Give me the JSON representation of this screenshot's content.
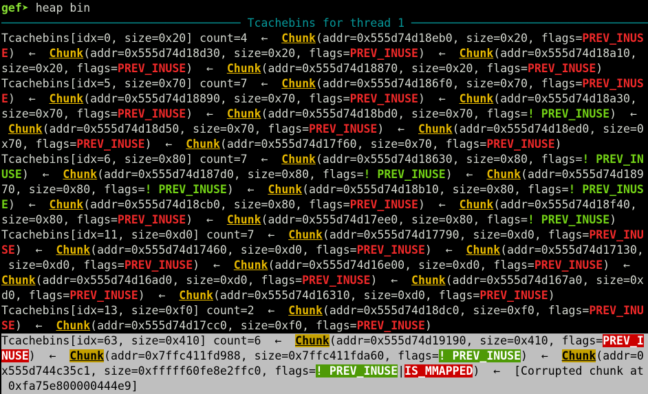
{
  "prompt": {
    "name": "gef",
    "arrow": "➤",
    "command": "heap bin"
  },
  "header": {
    "title": "Tcachebins for thread 1"
  },
  "colors": {
    "background": "#000000",
    "chunk": "#e6b800",
    "flag_inuse": "#ef2929",
    "flag_not_inuse": "#73d216",
    "header": "#06989a",
    "prompt": "#8ae234",
    "selection_background": "#bfbfbf"
  },
  "lines": [
    {
      "selected": false,
      "segs": [
        {
          "c": "plain",
          "t": "Tcachebins[idx=0, size=0x20] count=4  ←  "
        },
        {
          "c": "chunk",
          "t": "Chunk"
        },
        {
          "c": "plain",
          "t": "(addr=0x555d74d18eb0, size=0x20, flags="
        },
        {
          "c": "flag-red",
          "t": "PREV_INUS"
        }
      ]
    },
    {
      "selected": false,
      "segs": [
        {
          "c": "flag-red",
          "t": "E"
        },
        {
          "c": "plain",
          "t": ")  ←  "
        },
        {
          "c": "chunk",
          "t": "Chunk"
        },
        {
          "c": "plain",
          "t": "(addr=0x555d74d18d30, size=0x20, flags="
        },
        {
          "c": "flag-red",
          "t": "PREV_INUSE"
        },
        {
          "c": "plain",
          "t": ")  ←  "
        },
        {
          "c": "chunk",
          "t": "Chunk"
        },
        {
          "c": "plain",
          "t": "(addr=0x555d74d18a10,"
        }
      ]
    },
    {
      "selected": false,
      "segs": [
        {
          "c": "plain",
          "t": "size=0x20, flags="
        },
        {
          "c": "flag-red",
          "t": "PREV_INUSE"
        },
        {
          "c": "plain",
          "t": ")  ←  "
        },
        {
          "c": "chunk",
          "t": "Chunk"
        },
        {
          "c": "plain",
          "t": "(addr=0x555d74d18870, size=0x20, flags="
        },
        {
          "c": "flag-red",
          "t": "PREV_INUSE"
        },
        {
          "c": "plain",
          "t": ")"
        }
      ]
    },
    {
      "selected": false,
      "segs": [
        {
          "c": "plain",
          "t": "Tcachebins[idx=5, size=0x70] count=7  ←  "
        },
        {
          "c": "chunk",
          "t": "Chunk"
        },
        {
          "c": "plain",
          "t": "(addr=0x555d74d186f0, size=0x70, flags="
        },
        {
          "c": "flag-red",
          "t": "PREV_INUS"
        }
      ]
    },
    {
      "selected": false,
      "segs": [
        {
          "c": "flag-red",
          "t": "E"
        },
        {
          "c": "plain",
          "t": ")  ←  "
        },
        {
          "c": "chunk",
          "t": "Chunk"
        },
        {
          "c": "plain",
          "t": "(addr=0x555d74d18890, size=0x70, flags="
        },
        {
          "c": "flag-red",
          "t": "PREV_INUSE"
        },
        {
          "c": "plain",
          "t": ")  ←  "
        },
        {
          "c": "chunk",
          "t": "Chunk"
        },
        {
          "c": "plain",
          "t": "(addr=0x555d74d18a30,"
        }
      ]
    },
    {
      "selected": false,
      "segs": [
        {
          "c": "plain",
          "t": "size=0x70, flags="
        },
        {
          "c": "flag-red",
          "t": "PREV_INUSE"
        },
        {
          "c": "plain",
          "t": ")  ←  "
        },
        {
          "c": "chunk",
          "t": "Chunk"
        },
        {
          "c": "plain",
          "t": "(addr=0x555d74d18bd0, size=0x70, flags="
        },
        {
          "c": "flag-green",
          "t": "! PREV_INUSE"
        },
        {
          "c": "plain",
          "t": ")  ←"
        }
      ]
    },
    {
      "selected": false,
      "segs": [
        {
          "c": "plain",
          "t": " "
        },
        {
          "c": "chunk",
          "t": "Chunk"
        },
        {
          "c": "plain",
          "t": "(addr=0x555d74d18d50, size=0x70, flags="
        },
        {
          "c": "flag-red",
          "t": "PREV_INUSE"
        },
        {
          "c": "plain",
          "t": ")  ←  "
        },
        {
          "c": "chunk",
          "t": "Chunk"
        },
        {
          "c": "plain",
          "t": "(addr=0x555d74d18ed0, size=0"
        }
      ]
    },
    {
      "selected": false,
      "segs": [
        {
          "c": "plain",
          "t": "x70, flags="
        },
        {
          "c": "flag-red",
          "t": "PREV_INUSE"
        },
        {
          "c": "plain",
          "t": ")  ←  "
        },
        {
          "c": "chunk",
          "t": "Chunk"
        },
        {
          "c": "plain",
          "t": "(addr=0x555d74d17f60, size=0x70, flags="
        },
        {
          "c": "flag-red",
          "t": "PREV_INUSE"
        },
        {
          "c": "plain",
          "t": ")"
        }
      ]
    },
    {
      "selected": false,
      "segs": [
        {
          "c": "plain",
          "t": "Tcachebins[idx=6, size=0x80] count=7  ←  "
        },
        {
          "c": "chunk",
          "t": "Chunk"
        },
        {
          "c": "plain",
          "t": "(addr=0x555d74d18630, size=0x80, flags="
        },
        {
          "c": "flag-green",
          "t": "! PREV_IN"
        }
      ]
    },
    {
      "selected": false,
      "segs": [
        {
          "c": "flag-green",
          "t": "USE"
        },
        {
          "c": "plain",
          "t": ")  ←  "
        },
        {
          "c": "chunk",
          "t": "Chunk"
        },
        {
          "c": "plain",
          "t": "(addr=0x555d74d187d0, size=0x80, flags="
        },
        {
          "c": "flag-green",
          "t": "! PREV_INUSE"
        },
        {
          "c": "plain",
          "t": ")  ←  "
        },
        {
          "c": "chunk",
          "t": "Chunk"
        },
        {
          "c": "plain",
          "t": "(addr=0x555d74d189"
        }
      ]
    },
    {
      "selected": false,
      "segs": [
        {
          "c": "plain",
          "t": "70, size=0x80, flags="
        },
        {
          "c": "flag-green",
          "t": "! PREV_INUSE"
        },
        {
          "c": "plain",
          "t": ")  ←  "
        },
        {
          "c": "chunk",
          "t": "Chunk"
        },
        {
          "c": "plain",
          "t": "(addr=0x555d74d18b10, size=0x80, flags="
        },
        {
          "c": "flag-green",
          "t": "! PREV_INUS"
        }
      ]
    },
    {
      "selected": false,
      "segs": [
        {
          "c": "flag-green",
          "t": "E"
        },
        {
          "c": "plain",
          "t": ")  ←  "
        },
        {
          "c": "chunk",
          "t": "Chunk"
        },
        {
          "c": "plain",
          "t": "(addr=0x555d74d18cb0, size=0x80, flags="
        },
        {
          "c": "flag-red",
          "t": "PREV_INUSE"
        },
        {
          "c": "plain",
          "t": ")  ←  "
        },
        {
          "c": "chunk",
          "t": "Chunk"
        },
        {
          "c": "plain",
          "t": "(addr=0x555d74d18f40,"
        }
      ]
    },
    {
      "selected": false,
      "segs": [
        {
          "c": "plain",
          "t": "size=0x80, flags="
        },
        {
          "c": "flag-red",
          "t": "PREV_INUSE"
        },
        {
          "c": "plain",
          "t": ")  ←  "
        },
        {
          "c": "chunk",
          "t": "Chunk"
        },
        {
          "c": "plain",
          "t": "(addr=0x555d74d17ee0, size=0x80, flags="
        },
        {
          "c": "flag-green",
          "t": "! PREV_INUSE"
        },
        {
          "c": "plain",
          "t": ")"
        }
      ]
    },
    {
      "selected": false,
      "segs": [
        {
          "c": "plain",
          "t": "Tcachebins[idx=11, size=0xd0] count=7  ←  "
        },
        {
          "c": "chunk",
          "t": "Chunk"
        },
        {
          "c": "plain",
          "t": "(addr=0x555d74d17790, size=0xd0, flags="
        },
        {
          "c": "flag-red",
          "t": "PREV_INU"
        }
      ]
    },
    {
      "selected": false,
      "segs": [
        {
          "c": "flag-red",
          "t": "SE"
        },
        {
          "c": "plain",
          "t": ")  ←  "
        },
        {
          "c": "chunk",
          "t": "Chunk"
        },
        {
          "c": "plain",
          "t": "(addr=0x555d74d17460, size=0xd0, flags="
        },
        {
          "c": "flag-red",
          "t": "PREV_INUSE"
        },
        {
          "c": "plain",
          "t": ")  ←  "
        },
        {
          "c": "chunk",
          "t": "Chunk"
        },
        {
          "c": "plain",
          "t": "(addr=0x555d74d17130,"
        }
      ]
    },
    {
      "selected": false,
      "segs": [
        {
          "c": "plain",
          "t": " size=0xd0, flags="
        },
        {
          "c": "flag-red",
          "t": "PREV_INUSE"
        },
        {
          "c": "plain",
          "t": ")  ←  "
        },
        {
          "c": "chunk",
          "t": "Chunk"
        },
        {
          "c": "plain",
          "t": "(addr=0x555d74d16e00, size=0xd0, flags="
        },
        {
          "c": "flag-red",
          "t": "PREV_INUSE"
        },
        {
          "c": "plain",
          "t": ")  ←"
        }
      ]
    },
    {
      "selected": false,
      "segs": [
        {
          "c": "chunk",
          "t": "Chunk"
        },
        {
          "c": "plain",
          "t": "(addr=0x555d74d16ad0, size=0xd0, flags="
        },
        {
          "c": "flag-red",
          "t": "PREV_INUSE"
        },
        {
          "c": "plain",
          "t": ")  ←  "
        },
        {
          "c": "chunk",
          "t": "Chunk"
        },
        {
          "c": "plain",
          "t": "(addr=0x555d74d167a0, size=0x"
        }
      ]
    },
    {
      "selected": false,
      "segs": [
        {
          "c": "plain",
          "t": "d0, flags="
        },
        {
          "c": "flag-red",
          "t": "PREV_INUSE"
        },
        {
          "c": "plain",
          "t": ")  ←  "
        },
        {
          "c": "chunk",
          "t": "Chunk"
        },
        {
          "c": "plain",
          "t": "(addr=0x555d74d16310, size=0xd0, flags="
        },
        {
          "c": "flag-red",
          "t": "PREV_INUSE"
        },
        {
          "c": "plain",
          "t": ")"
        }
      ]
    },
    {
      "selected": false,
      "segs": [
        {
          "c": "plain",
          "t": "Tcachebins[idx=13, size=0xf0] count=2  ←  "
        },
        {
          "c": "chunk",
          "t": "Chunk"
        },
        {
          "c": "plain",
          "t": "(addr=0x555d74d18dc0, size=0xf0, flags="
        },
        {
          "c": "flag-red",
          "t": "PREV_INU"
        }
      ]
    },
    {
      "selected": false,
      "segs": [
        {
          "c": "flag-red",
          "t": "SE"
        },
        {
          "c": "plain",
          "t": ")  ←  "
        },
        {
          "c": "chunk",
          "t": "Chunk"
        },
        {
          "c": "plain",
          "t": "(addr=0x555d74d17cc0, size=0xf0, flags="
        },
        {
          "c": "flag-red",
          "t": "PREV_INUSE"
        },
        {
          "c": "plain",
          "t": ")"
        }
      ]
    },
    {
      "selected": true,
      "segs": [
        {
          "c": "plain",
          "t": "Tcachebins[idx=63, size=0x410] count=6  ←  "
        },
        {
          "c": "chunk",
          "t": "Chunk"
        },
        {
          "c": "plain",
          "t": "(addr=0x555d74d19190, size=0x410, flags="
        },
        {
          "c": "flag-red",
          "t": "PREV_I"
        }
      ]
    },
    {
      "selected": true,
      "segs": [
        {
          "c": "flag-red",
          "t": "NUSE"
        },
        {
          "c": "plain",
          "t": ")  ←  "
        },
        {
          "c": "chunk",
          "t": "Chunk"
        },
        {
          "c": "plain",
          "t": "(addr=0x7ffc411fd988, size=0x7ffc411fda60, flags="
        },
        {
          "c": "flag-green",
          "t": "! PREV_INUSE"
        },
        {
          "c": "plain",
          "t": ")  ←  "
        },
        {
          "c": "chunk",
          "t": "Chunk"
        },
        {
          "c": "plain",
          "t": "(addr=0"
        }
      ]
    },
    {
      "selected": true,
      "segs": [
        {
          "c": "plain",
          "t": "x555d744c35c1, size=0xfffff60fe8e2ffc0, flags="
        },
        {
          "c": "flag-green",
          "t": "! PREV_INUSE"
        },
        {
          "c": "plain",
          "t": "|"
        },
        {
          "c": "flag-red",
          "t": "IS_MMAPPED"
        },
        {
          "c": "plain",
          "t": ")  ←  [Corrupted chunk at"
        }
      ]
    },
    {
      "selected": true,
      "segs": [
        {
          "c": "plain",
          "t": " 0xfa75e800000444e9]"
        }
      ]
    }
  ]
}
